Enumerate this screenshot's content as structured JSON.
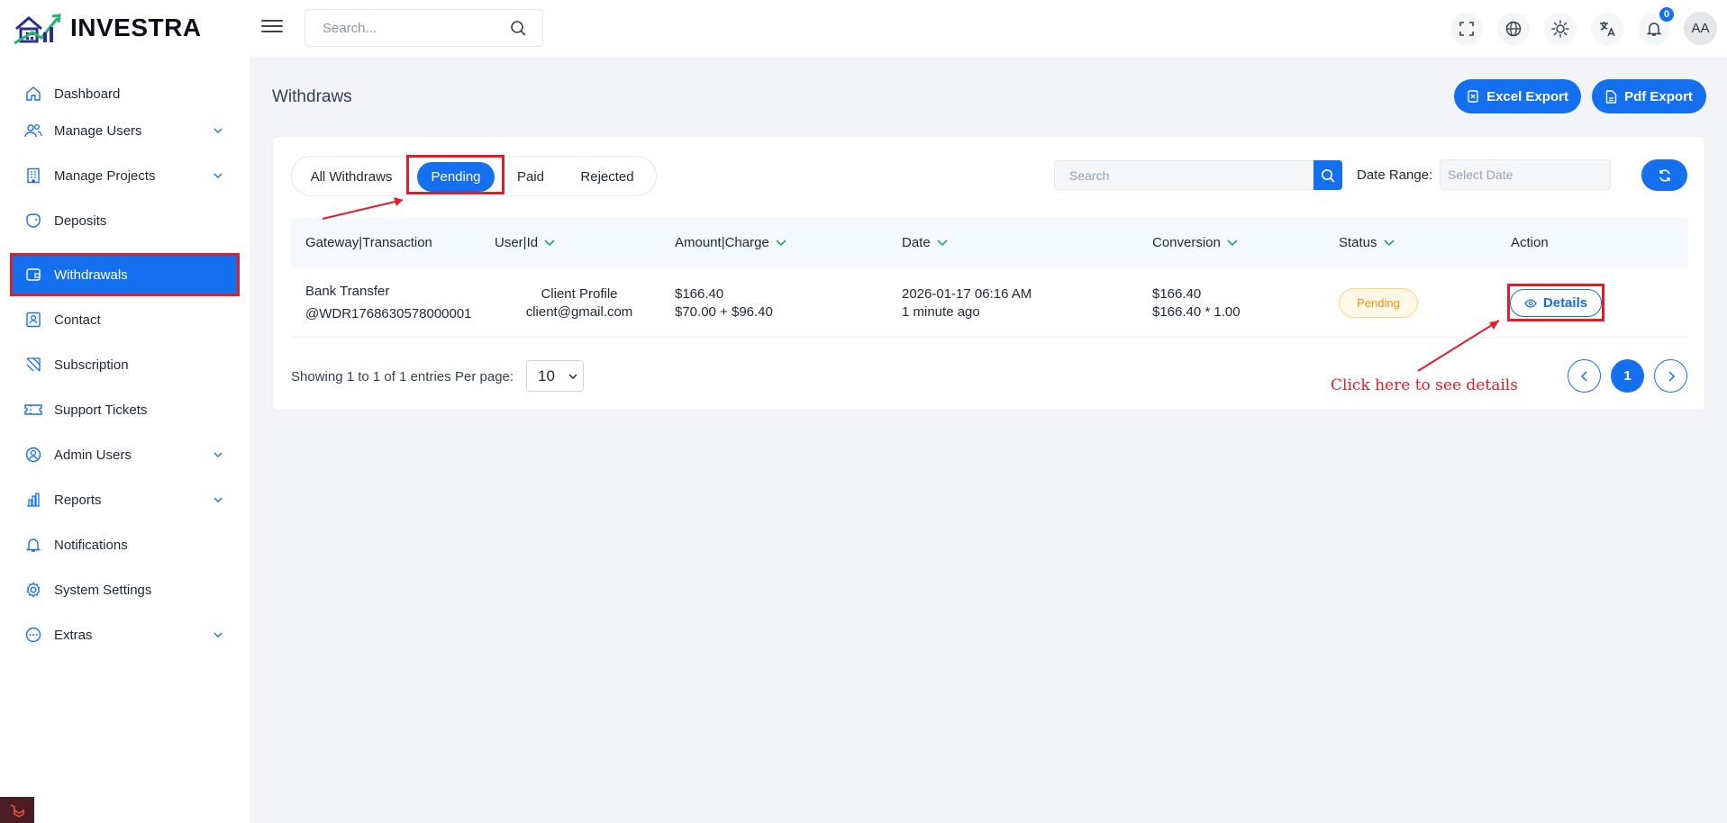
{
  "brand": {
    "name": "INVESTRA"
  },
  "topbar": {
    "search_placeholder": "Search...",
    "notifications_count": "0",
    "avatar_initials": "AA",
    "icons": [
      "fullscreen-icon",
      "globe-icon",
      "sun-icon",
      "translate-icon",
      "bell-icon"
    ]
  },
  "sidebar": {
    "items": [
      {
        "label": "Dashboard",
        "icon": "home-icon",
        "has_children": false
      },
      {
        "label": "Manage Users",
        "icon": "users-icon",
        "has_children": true
      },
      {
        "label": "Manage Projects",
        "icon": "building-icon",
        "has_children": true
      },
      {
        "label": "Deposits",
        "icon": "wallet-icon",
        "has_children": false
      },
      {
        "label": "Withdrawals",
        "icon": "withdraw-icon",
        "has_children": false,
        "active": true
      },
      {
        "label": "Contact",
        "icon": "contact-icon",
        "has_children": false
      },
      {
        "label": "Subscription",
        "icon": "subscription-icon",
        "has_children": false
      },
      {
        "label": "Support Tickets",
        "icon": "ticket-icon",
        "has_children": false
      },
      {
        "label": "Admin Users",
        "icon": "admin-icon",
        "has_children": true
      },
      {
        "label": "Reports",
        "icon": "reports-icon",
        "has_children": true
      },
      {
        "label": "Notifications",
        "icon": "bell-icon",
        "has_children": false
      },
      {
        "label": "System Settings",
        "icon": "gear-icon",
        "has_children": false
      },
      {
        "label": "Extras",
        "icon": "more-icon",
        "has_children": true
      }
    ]
  },
  "page": {
    "title": "Withdraws",
    "excel_export": "Excel Export",
    "pdf_export": "Pdf Export"
  },
  "tabs": [
    {
      "label": "All Withdraws",
      "active": false
    },
    {
      "label": "Pending",
      "active": true
    },
    {
      "label": "Paid",
      "active": false
    },
    {
      "label": "Rejected",
      "active": false
    }
  ],
  "filters": {
    "search_placeholder": "Search",
    "date_range_label": "Date Range:",
    "date_placeholder": "Select Date"
  },
  "table": {
    "columns": [
      "Gateway|Transaction",
      "User|Id",
      "Amount|Charge",
      "Date",
      "Conversion",
      "Status",
      "Action"
    ],
    "rows": [
      {
        "gateway": "Bank Transfer",
        "transaction": "@WDR1768630578000001",
        "user": "Client Profile",
        "email": "client@gmail.com",
        "amount": "$166.40",
        "amount_charge": "$70.00 + $96.40",
        "date": "2026-01-17 06:16 AM",
        "date_relative": "1 minute ago",
        "conversion": "$166.40",
        "conversion_detail": "$166.40 * 1.00",
        "status": "Pending",
        "action": "Details"
      }
    ]
  },
  "pagination": {
    "showing": "Showing 1 to 1 of 1 entries",
    "per_page_label": "Per page:",
    "per_page_value": "10",
    "current_page": "1"
  },
  "annotation": {
    "text": "Click here to see details"
  },
  "colors": {
    "accent": "#1570ef",
    "highlight": "#e11d2a",
    "pending": "#f79009"
  }
}
